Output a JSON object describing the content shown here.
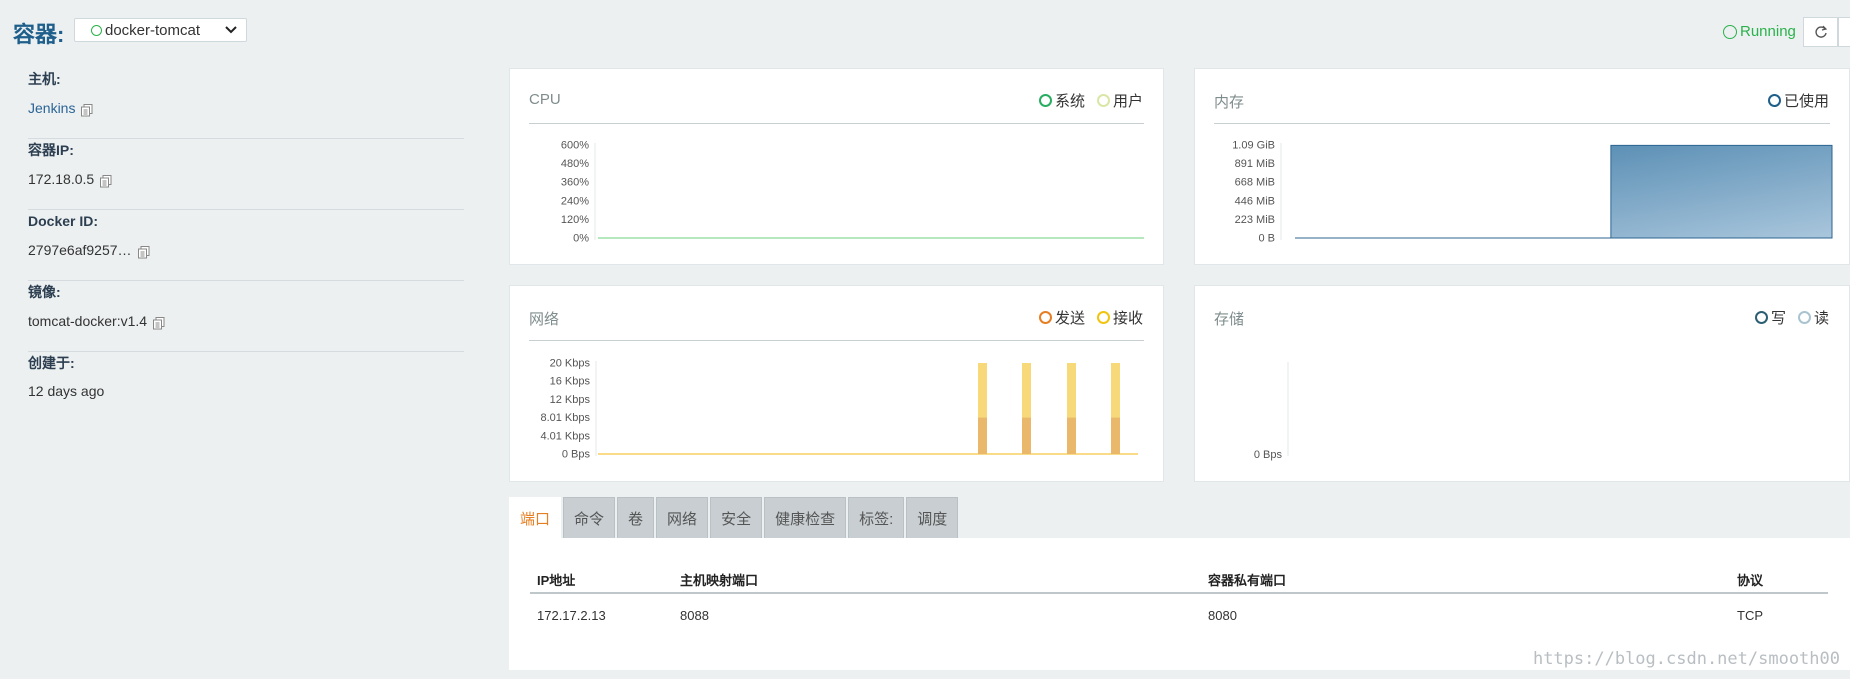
{
  "header": {
    "title": "容器:",
    "container_select": "docker-tomcat",
    "status": "Running",
    "colors": {
      "accent": "#1f5f8b",
      "running": "#2bb24c"
    }
  },
  "info": [
    {
      "label": "主机:",
      "value": "Jenkins",
      "copyable": true,
      "link": true
    },
    {
      "label": "容器IP:",
      "value": "172.18.0.5",
      "copyable": true,
      "link": false
    },
    {
      "label": "Docker ID:",
      "value": "2797e6af9257…",
      "copyable": true,
      "link": false
    },
    {
      "label": "镜像:",
      "value": "tomcat-docker:v1.4",
      "copyable": true,
      "link": false
    },
    {
      "label": "创建于:",
      "value": "12 days ago",
      "copyable": false,
      "link": false
    }
  ],
  "panels": {
    "cpu": {
      "title": "CPU",
      "legend": [
        {
          "label": "系统",
          "color": "#27ae60"
        },
        {
          "label": "用户",
          "color": "#d9e7a6"
        }
      ]
    },
    "memory": {
      "title": "内存",
      "legend": [
        {
          "label": "已使用",
          "color": "#1f5f8b"
        }
      ]
    },
    "network": {
      "title": "网络",
      "legend": [
        {
          "label": "发送",
          "color": "#e67e22"
        },
        {
          "label": "接收",
          "color": "#f1c40f"
        }
      ]
    },
    "storage": {
      "title": "存储",
      "legend": [
        {
          "label": "写",
          "color": "#2c5f74"
        },
        {
          "label": "读",
          "color": "#a9c4cf"
        }
      ]
    }
  },
  "chart_data": [
    {
      "type": "line",
      "id": "cpu",
      "title": "CPU",
      "yticks": [
        "600%",
        "480%",
        "360%",
        "240%",
        "120%",
        "0%"
      ],
      "ylim": [
        0,
        600
      ],
      "series": [
        {
          "name": "系统",
          "values": [
            0,
            0,
            0,
            0,
            0,
            0,
            0,
            0,
            0,
            0
          ]
        }
      ]
    },
    {
      "type": "area",
      "id": "memory",
      "title": "内存",
      "yticks": [
        "1.09 GiB",
        "891 MiB",
        "668 MiB",
        "446 MiB",
        "223 MiB",
        "0 B"
      ],
      "ylim": [
        0,
        1114
      ],
      "series": [
        {
          "name": "已使用",
          "values": [
            0,
            0,
            0,
            0,
            0,
            0,
            0,
            0,
            0,
            0,
            0,
            1110,
            1110,
            1110,
            1110,
            1110,
            1110,
            1110
          ]
        }
      ]
    },
    {
      "type": "bar",
      "id": "network",
      "title": "网络",
      "yticks": [
        "20 Kbps",
        "16 Kbps",
        "12 Kbps",
        "8.01 Kbps",
        "4.01 Kbps",
        "0 Bps"
      ],
      "ylim": [
        0,
        20
      ],
      "series": [
        {
          "name": "发送",
          "values": [
            8,
            8,
            8,
            8
          ]
        },
        {
          "name": "接收",
          "values": [
            20,
            20,
            20,
            20
          ]
        }
      ]
    },
    {
      "type": "line",
      "id": "storage",
      "title": "存储",
      "yticks": [
        "0 Bps"
      ],
      "ylim": [
        0,
        1
      ],
      "series": []
    }
  ],
  "tabs": [
    {
      "label": "端口",
      "active": true
    },
    {
      "label": "命令",
      "active": false
    },
    {
      "label": "卷",
      "active": false
    },
    {
      "label": "网络",
      "active": false
    },
    {
      "label": "安全",
      "active": false
    },
    {
      "label": "健康检查",
      "active": false
    },
    {
      "label": "标签:",
      "active": false
    },
    {
      "label": "调度",
      "active": false
    }
  ],
  "ports": {
    "headers": [
      "IP地址",
      "主机映射端口",
      "容器私有端口",
      "协议"
    ],
    "rows": [
      [
        "172.17.2.13",
        "8088",
        "8080",
        "TCP"
      ]
    ]
  },
  "watermark": "https://blog.csdn.net/smooth00"
}
